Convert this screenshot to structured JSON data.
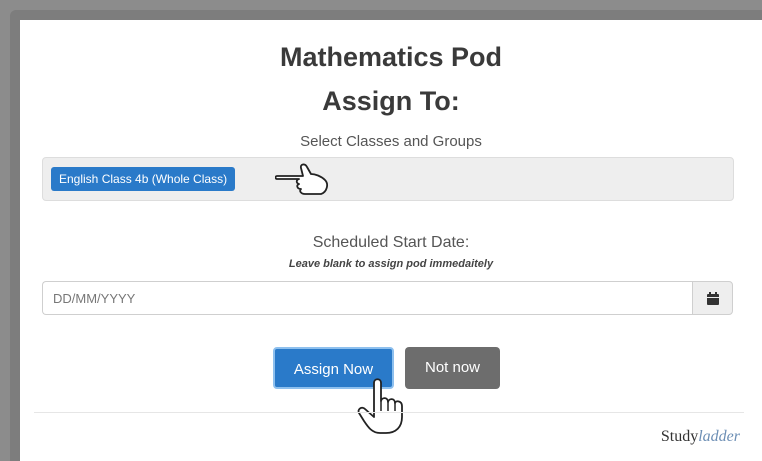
{
  "modal": {
    "title": "Mathematics Pod",
    "subtitle": "Assign To:",
    "select_label": "Select Classes and Groups",
    "selected_chip": "English Class 4b (Whole Class)",
    "date_label": "Scheduled Start Date:",
    "date_hint": "Leave blank to assign pod immedaitely",
    "date_placeholder": "DD/MM/YYYY",
    "assign_button": "Assign Now",
    "not_now_button": "Not now"
  },
  "brand": {
    "study": "Study",
    "ladder": "ladder"
  },
  "icons": {
    "calendar": "calendar-icon",
    "pointing_hand": "pointing-hand-icon",
    "click_hand": "click-hand-icon"
  },
  "colors": {
    "primary": "#2a7ac9",
    "secondary": "#6d6d6d"
  }
}
